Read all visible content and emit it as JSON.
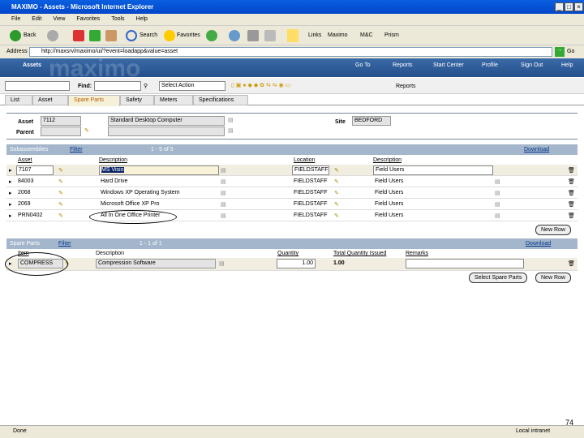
{
  "window": {
    "title": "MAXIMO - Assets - Microsoft Internet Explorer"
  },
  "menu": [
    "File",
    "Edit",
    "View",
    "Favorites",
    "Tools",
    "Help"
  ],
  "ie_toolbar": {
    "back": "Back",
    "search": "Search",
    "favorites": "Favorites",
    "links": "Links",
    "link1": "Maximo",
    "link2": "M&C",
    "link3": "Prism"
  },
  "address": {
    "label": "Address",
    "url": "http://maxsrv/maximo/ui/?event=loadapp&value=asset",
    "go": "Go"
  },
  "app": {
    "title": "Assets",
    "logo": "maximo",
    "nav": [
      "Go To",
      "Reports",
      "Start Center",
      "Profile",
      "Sign Out",
      "Help"
    ]
  },
  "toolbar": {
    "find_label": "Find:",
    "select_action": "Select Action",
    "reports": "Reports"
  },
  "tabs": [
    "List",
    "Asset",
    "Spare Parts",
    "Safety",
    "Meters",
    "Specifications"
  ],
  "asset": {
    "asset_label": "Asset",
    "asset_value": "7112",
    "description": "Standard Desktop Computer",
    "site_label": "Site",
    "site_value": "BEDFORD",
    "parent_label": "Parent",
    "parent_value": ""
  },
  "subassemblies": {
    "title": "Subassemblies",
    "filter": "Filter",
    "pager": "1 - 5 of 5",
    "download": "Download",
    "columns": [
      "Asset",
      "Description",
      "Location",
      "Description"
    ],
    "rows": [
      {
        "asset": "7107",
        "description": "MS Visio",
        "location": "FIELDSTAFF",
        "loc_desc": "Field Users"
      },
      {
        "asset": "84003",
        "description": "Hard Drive",
        "location": "FIELDSTAFF",
        "loc_desc": "Field Users"
      },
      {
        "asset": "2068",
        "description": "Windows XP Operating System",
        "location": "FIELDSTAFF",
        "loc_desc": "Field Users"
      },
      {
        "asset": "2069",
        "description": "Microsoft Office XP Pro",
        "location": "FIELDSTAFF",
        "loc_desc": "Field Users"
      },
      {
        "asset": "PRN0402",
        "description": "All In One Office Printer",
        "location": "FIELDSTAFF",
        "loc_desc": "Field Users"
      }
    ],
    "new_row": "New Row"
  },
  "spare_parts": {
    "title": "Spare Parts",
    "filter": "Filter",
    "pager": "1 - 1 of 1",
    "download": "Download",
    "columns": [
      "Item",
      "Description",
      "Quantity",
      "Total Quantity Issued",
      "Remarks"
    ],
    "rows": [
      {
        "item": "COMPRESS",
        "description": "Compression Software",
        "quantity": "1.00",
        "issued": "1.00",
        "remarks": ""
      }
    ],
    "select_button": "Select Spare Parts",
    "new_row": "New Row"
  },
  "status": {
    "left": "Done",
    "zone": "Local intranet"
  },
  "page_number": "74"
}
